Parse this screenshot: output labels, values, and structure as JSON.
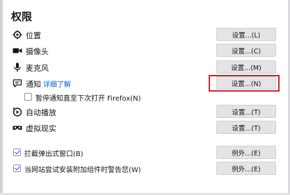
{
  "section_title": "权限",
  "permissions": [
    {
      "label": "位置",
      "icon": "location-icon",
      "button": "设置...(L)"
    },
    {
      "label": "摄像头",
      "icon": "camera-icon",
      "button": "设置...(C)"
    },
    {
      "label": "麦克风",
      "icon": "microphone-icon",
      "button": "设置...(M)"
    },
    {
      "label": "通知",
      "icon": "notification-icon",
      "link": "详细了解",
      "button": "设置...(N)"
    },
    {
      "label": "自动播放",
      "icon": "autoplay-icon",
      "button": "设置...(T)"
    },
    {
      "label": "虚拟现实",
      "icon": "vr-headset-icon",
      "button": "设置...(T)"
    }
  ],
  "pause_notifications": {
    "label": "暂停通知直至下次打开 Firefox(N)",
    "checked": false
  },
  "block_popups": {
    "label": "拦截弹出式窗口(B)",
    "checked": true,
    "button": "例外...(E)"
  },
  "addon_warning": {
    "label": "当网站尝试安装附加组件时警告您(W)",
    "checked": true,
    "button": "例外...(E)"
  },
  "colors": {
    "accent": "#0061e0",
    "highlight": "#d0212b",
    "button_bg": "#e4e4e6"
  }
}
